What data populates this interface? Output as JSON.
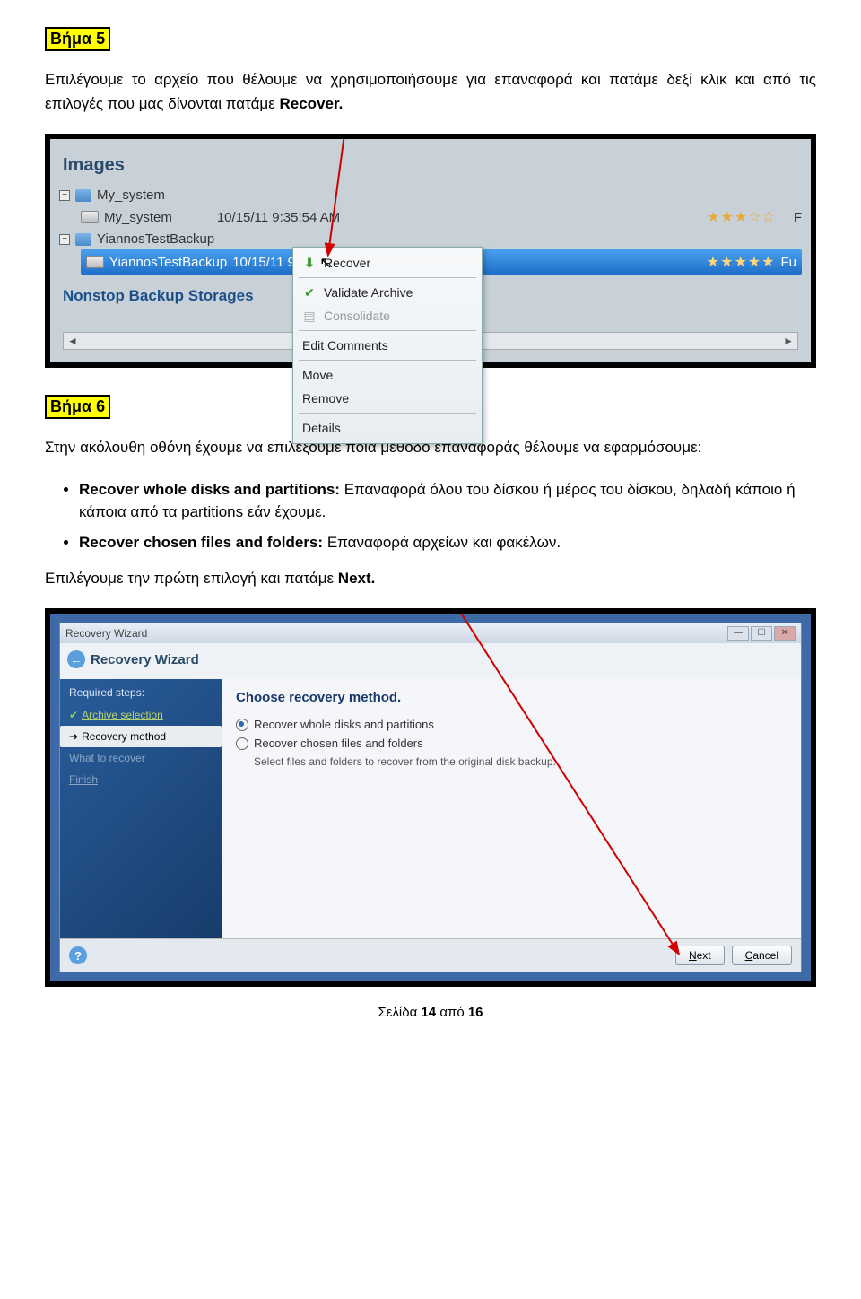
{
  "step5": {
    "label": "Βήμα 5",
    "para_before": "Επιλέγουμε το αρχείο που θέλουμε να χρησιμοποιήσουμε για επαναφορά και πατάμε δεξί κλικ και από τις επιλογές που μας δίνονται πατάμε ",
    "para_bold": "Recover."
  },
  "screenshot1": {
    "images_title": "Images",
    "tree": {
      "folder1": "My_system",
      "item1": "My_system",
      "item1_date": "10/15/11 9:35:54 AM",
      "item1_rating_suffix": "F",
      "folder2": "YiannosTestBackup",
      "highlighted": "YiannosTestBackup",
      "highlighted_date": "10/15/11 9:47:02",
      "highlighted_suffix": "Fu"
    },
    "nonstop": "Nonstop Backup Storages",
    "menu": {
      "recover": "Recover",
      "validate": "Validate Archive",
      "consolidate": "Consolidate",
      "edit": "Edit Comments",
      "move": "Move",
      "remove": "Remove",
      "details": "Details"
    }
  },
  "step6": {
    "label": "Βήμα 6",
    "para": "Στην ακόλουθη οθόνη έχουμε να επιλέξουμε ποια μέθοδο επαναφοράς θέλουμε να εφαρμόσουμε:",
    "bullet1_bold": "Recover whole disks and partitions:",
    "bullet1_rest": " Επαναφορά όλου του δίσκου ή μέρος του δίσκου, δηλαδή κάποιο ή κάποια από τα partitions εάν έχουμε.",
    "bullet2_bold": "Recover chosen files and folders:",
    "bullet2_rest": " Επαναφορά αρχείων και φακέλων.",
    "after": "Επιλέγουμε την πρώτη επιλογή και πατάμε ",
    "after_bold": "Next."
  },
  "screenshot2": {
    "titlebar": "Recovery Wizard",
    "header": "Recovery Wizard",
    "sidebar": {
      "required": "Required steps:",
      "archive": "Archive selection",
      "method": "Recovery method",
      "what": "What to recover",
      "finish": "Finish"
    },
    "main": {
      "title": "Choose recovery method.",
      "opt1": "Recover whole disks and partitions",
      "opt2": "Recover chosen files and folders",
      "desc": "Select files and folders to recover from the original disk backup."
    },
    "buttons": {
      "next": "Next",
      "cancel": "Cancel"
    }
  },
  "footer": {
    "prefix": "Σελίδα ",
    "page": "14",
    "mid": " από ",
    "total": "16"
  }
}
